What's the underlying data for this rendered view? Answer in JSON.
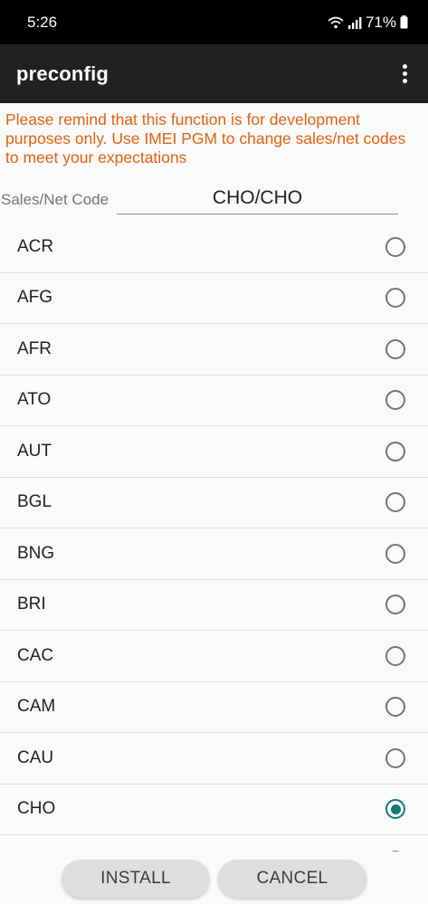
{
  "status_bar": {
    "time": "5:26",
    "battery_percent": "71%",
    "icons": [
      "wifi-icon",
      "signal-icon",
      "battery-icon"
    ]
  },
  "app_bar": {
    "title": "preconfig",
    "overflow_icon": "more-vert-icon"
  },
  "warning": {
    "text": "Please remind that this function is for development purposes only. Use IMEI PGM to change sales/net codes to meet your expectations",
    "color": "#e2620f"
  },
  "code_field": {
    "label": "Sales/Net Code",
    "value": "CHO/CHO"
  },
  "list": {
    "items": [
      {
        "label": "ACR",
        "selected": false
      },
      {
        "label": "AFG",
        "selected": false
      },
      {
        "label": "AFR",
        "selected": false
      },
      {
        "label": "ATO",
        "selected": false
      },
      {
        "label": "AUT",
        "selected": false
      },
      {
        "label": "BGL",
        "selected": false
      },
      {
        "label": "BNG",
        "selected": false
      },
      {
        "label": "BRI",
        "selected": false
      },
      {
        "label": "CAC",
        "selected": false
      },
      {
        "label": "CAM",
        "selected": false
      },
      {
        "label": "CAU",
        "selected": false
      },
      {
        "label": "CHO",
        "selected": true
      },
      {
        "label": "",
        "selected": false
      }
    ],
    "accent_color": "#0d7d72"
  },
  "buttons": {
    "install_label": "INSTALL",
    "cancel_label": "CANCEL"
  }
}
